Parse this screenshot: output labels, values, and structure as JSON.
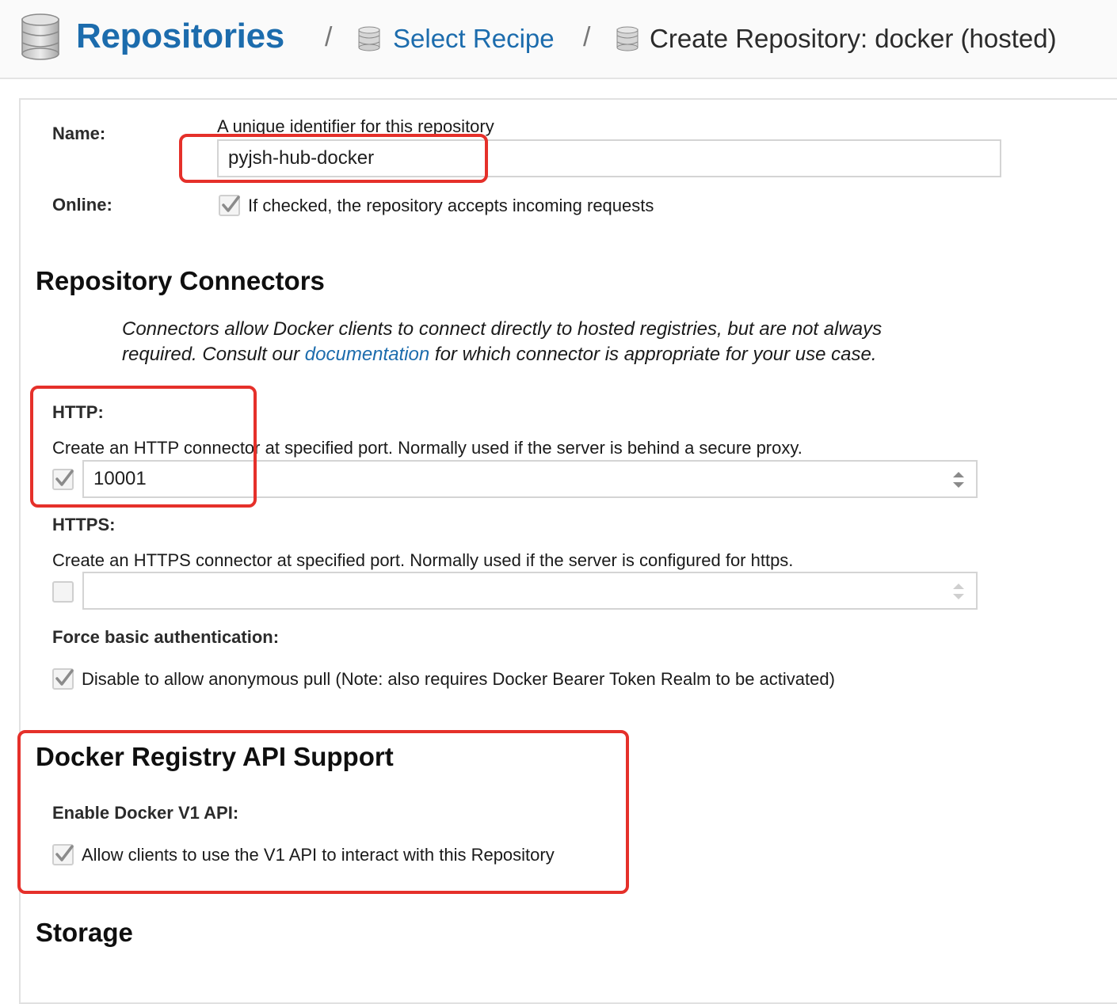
{
  "breadcrumb": {
    "root": "Repositories",
    "separator": "/",
    "recipe": "Select Recipe",
    "current": "Create Repository: docker (hosted)"
  },
  "name_field": {
    "label": "Name:",
    "help": "A unique identifier for this repository",
    "value": "pyjsh-hub-docker"
  },
  "online": {
    "label": "Online:",
    "checked": true,
    "text": "If checked, the repository accepts incoming requests"
  },
  "connectors": {
    "heading": "Repository Connectors",
    "intro_before": "Connectors allow Docker clients to connect directly to hosted registries, but are not always required. Consult our ",
    "intro_link": "documentation",
    "intro_after": " for which connector is appropriate for your use case.",
    "http": {
      "label": "HTTP:",
      "help": "Create an HTTP connector at specified port. Normally used if the server is behind a secure proxy.",
      "checked": true,
      "value": "10001"
    },
    "https": {
      "label": "HTTPS:",
      "help": "Create an HTTPS connector at specified port. Normally used if the server is configured for https.",
      "checked": false,
      "value": ""
    },
    "force_basic_auth": {
      "label": "Force basic authentication:",
      "checked": true,
      "text": "Disable to allow anonymous pull (Note: also requires Docker Bearer Token Realm to be activated)"
    }
  },
  "docker_api": {
    "heading": "Docker Registry API Support",
    "v1_label": "Enable Docker V1 API:",
    "v1_checked": true,
    "v1_text": "Allow clients to use the V1 API to interact with this Repository"
  },
  "storage": {
    "heading": "Storage"
  },
  "colors": {
    "link": "#1c6cad",
    "highlight": "#e5302a"
  }
}
